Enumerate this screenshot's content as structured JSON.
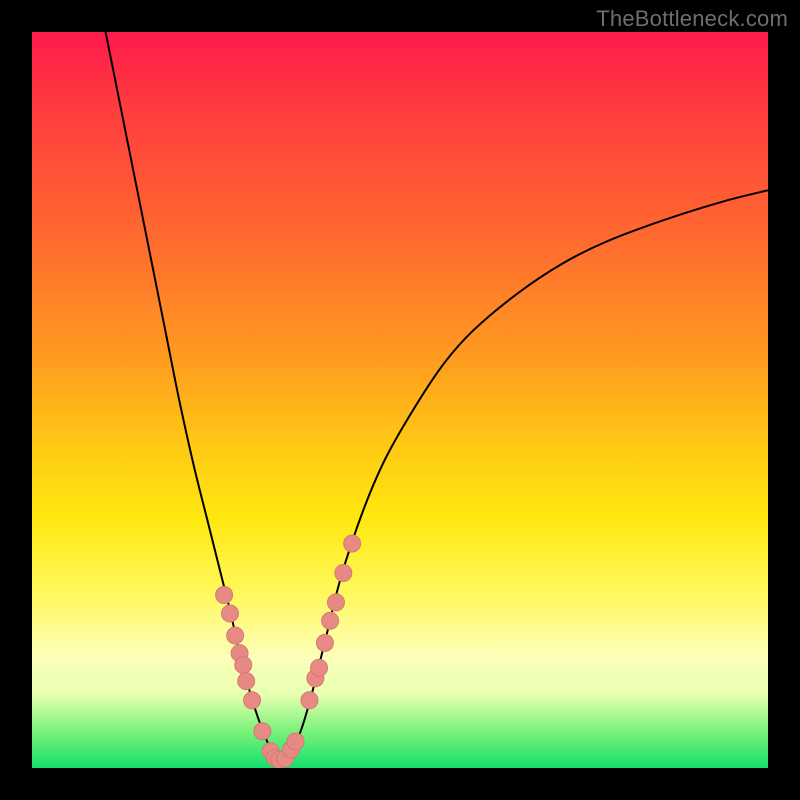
{
  "watermark": "TheBottleneck.com",
  "colors": {
    "curve": "#000000",
    "marker_fill": "#e78a84",
    "marker_stroke": "#d47a74",
    "background_black": "#000000"
  },
  "chart_data": {
    "type": "line",
    "title": "",
    "xlabel": "",
    "ylabel": "",
    "xlim": [
      0,
      100
    ],
    "ylim": [
      0,
      100
    ],
    "series": [
      {
        "name": "left-branch",
        "x": [
          10,
          12,
          14,
          16,
          18,
          20,
          22,
          24,
          25.5,
          27,
          28,
          29,
          30,
          31,
          32,
          33,
          33.5
        ],
        "y": [
          100,
          90,
          80,
          70,
          60,
          50,
          41,
          33,
          27,
          21,
          16.5,
          12.5,
          9,
          6,
          3.5,
          1.5,
          1
        ]
      },
      {
        "name": "right-branch",
        "x": [
          33.5,
          35,
          36.5,
          38,
          40,
          42,
          45,
          48,
          52,
          56,
          60,
          66,
          72,
          78,
          86,
          94,
          100
        ],
        "y": [
          1,
          2,
          5,
          10,
          18,
          26,
          35,
          42,
          49,
          55,
          59.5,
          64.5,
          68.5,
          71.5,
          74.5,
          77,
          78.5
        ]
      }
    ],
    "markers": [
      {
        "x": 26.1,
        "y": 23.5
      },
      {
        "x": 26.9,
        "y": 21.0
      },
      {
        "x": 27.6,
        "y": 18.0
      },
      {
        "x": 28.2,
        "y": 15.6
      },
      {
        "x": 28.7,
        "y": 14.0
      },
      {
        "x": 29.1,
        "y": 11.8
      },
      {
        "x": 29.9,
        "y": 9.2
      },
      {
        "x": 31.3,
        "y": 5.0
      },
      {
        "x": 32.4,
        "y": 2.3
      },
      {
        "x": 33.0,
        "y": 1.4
      },
      {
        "x": 33.6,
        "y": 1.1
      },
      {
        "x": 34.4,
        "y": 1.3
      },
      {
        "x": 35.2,
        "y": 2.5
      },
      {
        "x": 35.8,
        "y": 3.6
      },
      {
        "x": 37.7,
        "y": 9.2
      },
      {
        "x": 38.5,
        "y": 12.2
      },
      {
        "x": 39.0,
        "y": 13.6
      },
      {
        "x": 39.8,
        "y": 17.0
      },
      {
        "x": 40.5,
        "y": 20.0
      },
      {
        "x": 41.3,
        "y": 22.5
      },
      {
        "x": 42.3,
        "y": 26.5
      },
      {
        "x": 43.5,
        "y": 30.5
      }
    ]
  }
}
